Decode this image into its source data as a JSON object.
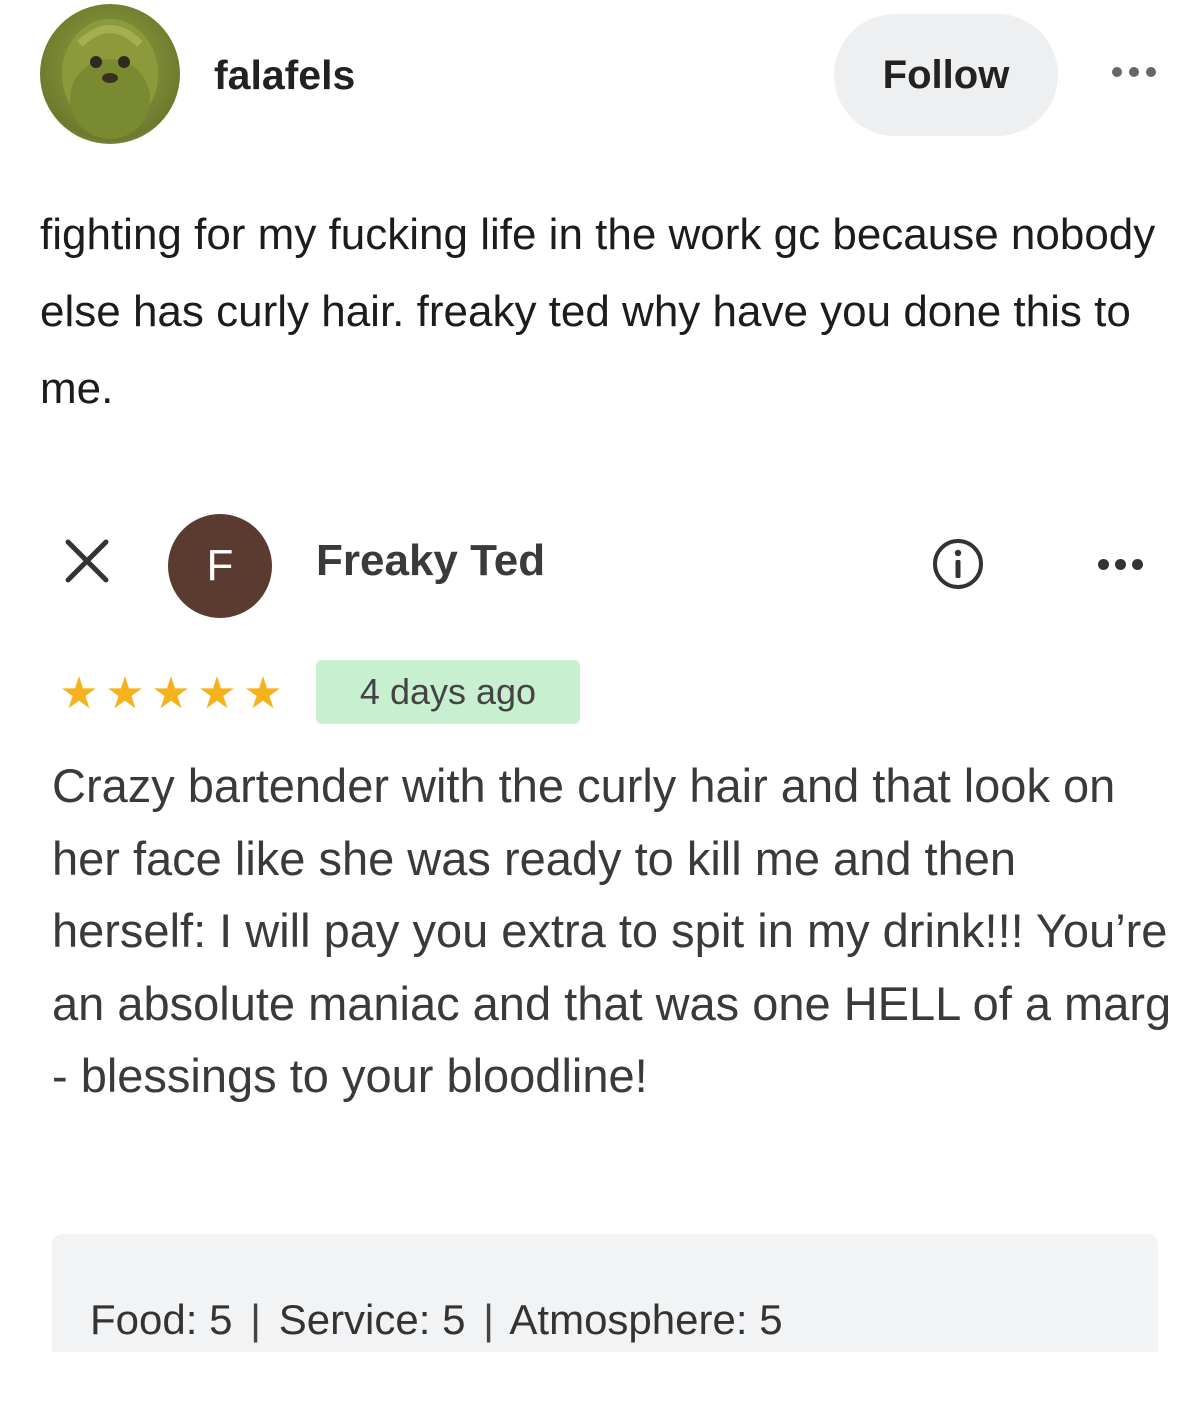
{
  "post": {
    "username": "falafels",
    "follow_label": "Follow",
    "text": "fighting for my fucking life in the work gc because nobody else has curly hair. freaky ted why have you done this to me."
  },
  "review": {
    "avatar_letter": "F",
    "reviewer_name": "Freaky Ted",
    "stars": 5,
    "star_glyphs": [
      "★",
      "★",
      "★",
      "★",
      "★"
    ],
    "time_ago": "4 days ago",
    "text": "Crazy bartender with the curly hair and that look on her face like she was ready to kill me and then herself: I will pay you extra to spit in my drink!!! You’re an absolute maniac and that was one HELL of a marg - blessings to your bloodline!",
    "ratings": {
      "food": "Food: 5",
      "service": "Service: 5",
      "atmosphere": "Atmosphere: 5",
      "separator": "|"
    }
  },
  "colors": {
    "star": "#f5b21c",
    "badge_bg": "#c8efd0",
    "avatar_bg": "#5b3a2f",
    "follow_bg": "#eeeff1"
  },
  "icons": {
    "close": "close-icon",
    "info": "info-icon",
    "more": "more-icon"
  }
}
